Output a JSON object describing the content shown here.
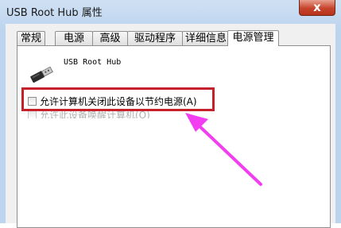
{
  "window": {
    "title": "USB Root Hub 属性",
    "close_glyph": "x"
  },
  "tabs": [
    {
      "label": "常规"
    },
    {
      "label": "电源"
    },
    {
      "label": "高级"
    },
    {
      "label": "驱动程序"
    },
    {
      "label": "详细信息"
    },
    {
      "label": "电源管理",
      "active": true
    }
  ],
  "device": {
    "name": "USB Root Hub",
    "icon": "usb-plug-icon"
  },
  "options": {
    "allow_turn_off": {
      "label": "允许计算机关闭此设备以节约电源(A)",
      "checked": false
    },
    "allow_wake": {
      "label": "允许此设备唤醒计算机(O)",
      "checked": false,
      "disabled": true
    }
  },
  "annotation": {
    "highlight_color": "#c6202a",
    "arrow_color": "#f23ef0"
  }
}
